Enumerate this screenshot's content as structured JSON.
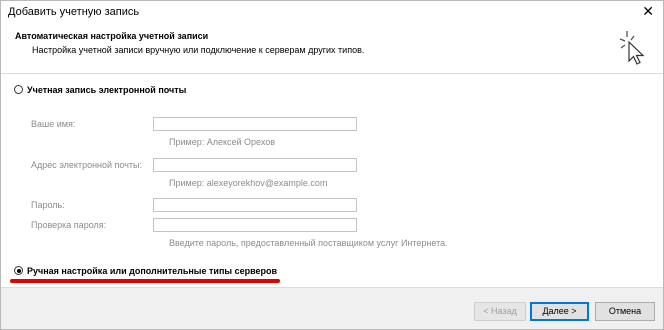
{
  "window": {
    "title": "Добавить учетную запись",
    "close_label": "✕"
  },
  "header": {
    "title": "Автоматическая настройка учетной записи",
    "subtitle": "Настройка учетной записи вручную или подключение к серверам других типов."
  },
  "options": {
    "email_account_label": "Учетная запись электронной почты",
    "manual_setup_label": "Ручная настройка или дополнительные типы серверов",
    "selected": "manual_setup"
  },
  "form": {
    "name_label": "Ваше имя:",
    "name_value": "",
    "name_hint": "Пример: Алексей Орехов",
    "email_label": "Адрес электронной почты:",
    "email_value": "",
    "email_hint": "Пример: alexeyorekhov@example.com",
    "password_label": "Пароль:",
    "password_confirm_label": "Проверка пароля:",
    "password_hint": "Введите пароль, предоставленный поставщиком услуг Интернета."
  },
  "buttons": {
    "back": "< Назад",
    "next": "Далее >",
    "cancel": "Отмена"
  },
  "colors": {
    "accent": "#0078d7",
    "highlight": "#e00000"
  }
}
